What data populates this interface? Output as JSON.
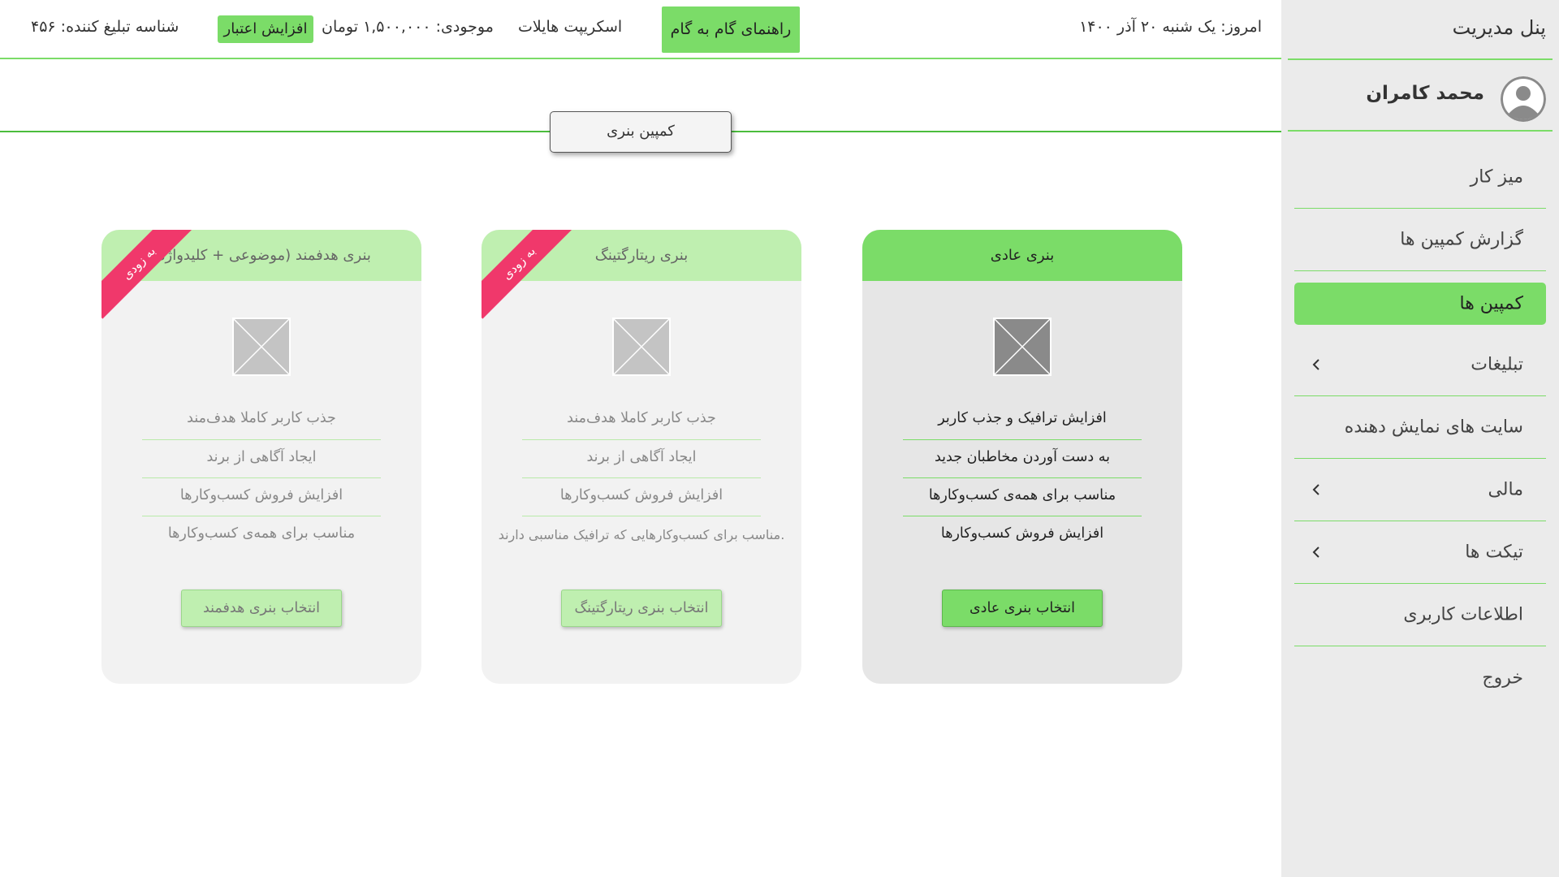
{
  "sidebar": {
    "title": "پنل مدیریت",
    "user_name": "محمد کامران",
    "items": [
      {
        "label": "میز کار"
      },
      {
        "label": "گزارش کمپین ها"
      },
      {
        "label": "کمپین ها"
      },
      {
        "label": "تبلیغات"
      },
      {
        "label": "سایت های نمایش دهنده"
      },
      {
        "label": "مالی"
      },
      {
        "label": "تیکت ها"
      },
      {
        "label": "اطلاعات کاربری"
      },
      {
        "label": "خروج"
      }
    ],
    "active_item": "کمپین ها"
  },
  "header": {
    "date": "امروز: یک شنبه ۲۰ آذر ۱۴۰۰",
    "guide_button": "راهنمای گام به گام",
    "hilight_script": "اسکریپت هایلات",
    "balance": "موجودی: ۱,۵۰۰,۰۰۰ تومان",
    "increase_button": "افزایش اعتبار",
    "advertiser_id": "شناسه تبلیغ کننده: ۴۵۶"
  },
  "section": {
    "tab_label": "کمپین بنری"
  },
  "cards": [
    {
      "title": "بنری عادی",
      "features": [
        "افزایش ترافیک و جذب کاربر",
        "به دست آوردن مخاطبان جدید",
        "مناسب برای همه‌ی کسب‌وکارها",
        "افزایش فروش کسب‌وکارها"
      ],
      "button": "انتخاب بنری عادی"
    },
    {
      "title": "بنری ریتارگتینگ",
      "ribbon": "به زودی",
      "features": [
        "جذب کاربر کاملا هدف‌مند",
        "ایجاد آگاهی از برند",
        "افزایش فروش کسب‌وکارها",
        "مناسب برای کسب‌وکارهایی که ترافیک مناسبی دارند."
      ],
      "button": "انتخاب بنری ریتارگتینگ"
    },
    {
      "title": "بنری هدفمند (موضوعی + کلیدواژه)",
      "ribbon": "به زودی",
      "features": [
        "جذب کاربر کاملا هدف‌مند",
        "ایجاد آگاهی از برند",
        "افزایش فروش کسب‌وکارها",
        "مناسب برای همه‌ی کسب‌وکارها"
      ],
      "button": "انتخاب بنری هدفمند"
    }
  ],
  "colors": {
    "accent": "#7bdc68",
    "accent_light": "#bfefb0",
    "ribbon": "#f0386b",
    "sidebar_bg": "#ebebeb"
  },
  "icons": {
    "image_placeholder": "image-placeholder-icon",
    "avatar": "user-avatar-icon",
    "chevron": "chevron-left-icon"
  }
}
